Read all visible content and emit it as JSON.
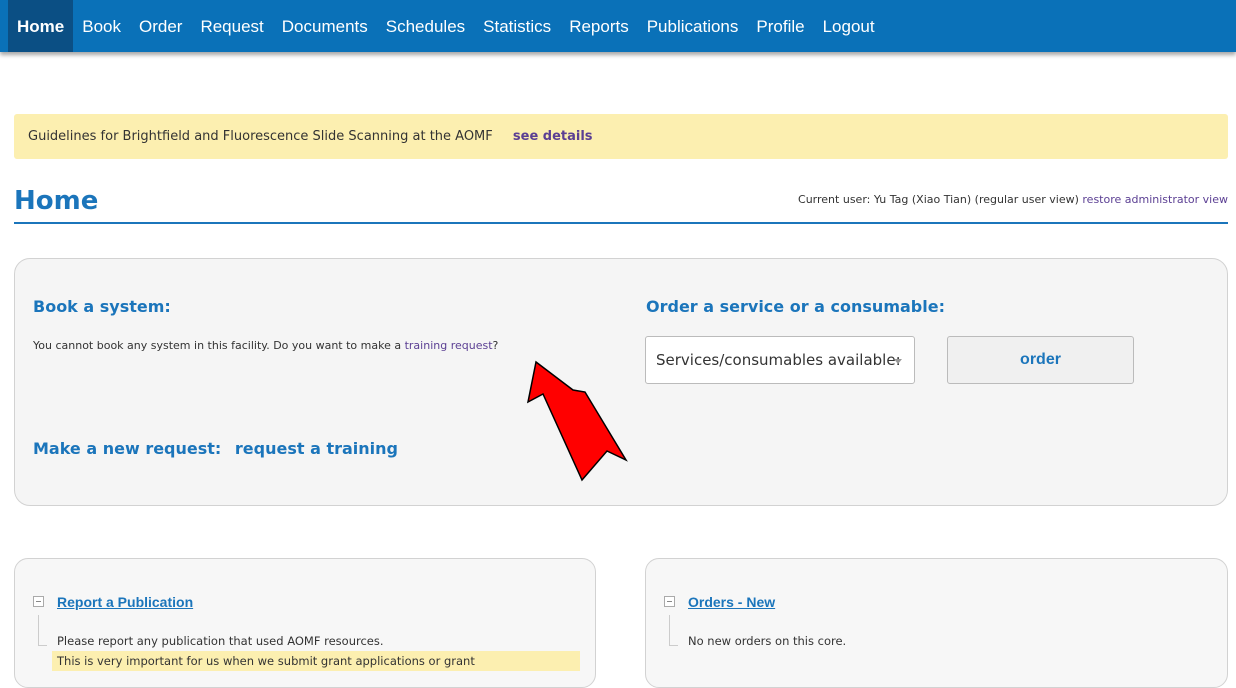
{
  "nav": {
    "items": [
      {
        "label": "Home",
        "active": true
      },
      {
        "label": "Book"
      },
      {
        "label": "Order"
      },
      {
        "label": "Request"
      },
      {
        "label": "Documents"
      },
      {
        "label": "Schedules"
      },
      {
        "label": "Statistics"
      },
      {
        "label": "Reports"
      },
      {
        "label": "Publications"
      },
      {
        "label": "Profile"
      },
      {
        "label": "Logout"
      }
    ]
  },
  "banner": {
    "text": "Guidelines for Brightfield and Fluorescence Slide Scanning at the AOMF",
    "link": "see details"
  },
  "page": {
    "title": "Home",
    "user_prefix": "Current user: Yu Tag (Xiao Tian) (regular user view)",
    "restore_link": "restore administrator view"
  },
  "book": {
    "heading": "Book a system:",
    "desc_prefix": "You cannot book any system in this facility. Do you want to make a",
    "desc_link": "training request",
    "desc_suffix": "?"
  },
  "request": {
    "heading": "Make a new request:",
    "link": "request a training"
  },
  "order": {
    "heading": "Order a service or a consumable:",
    "select_value": "Services/consumables available:",
    "button": "order"
  },
  "cards": {
    "publication": {
      "title": "Report a Publication",
      "text": "Please report any publication that used AOMF resources.",
      "highlight": "This is very important for us when we submit grant applications or grant"
    },
    "orders": {
      "title": "Orders - New",
      "text": "No new orders on this core."
    }
  },
  "colors": {
    "nav_bg": "#0a71b8",
    "accent": "#1b75bb",
    "link": "#5b3f93",
    "banner_bg": "#fcefb0",
    "arrow": "#ff0000"
  }
}
